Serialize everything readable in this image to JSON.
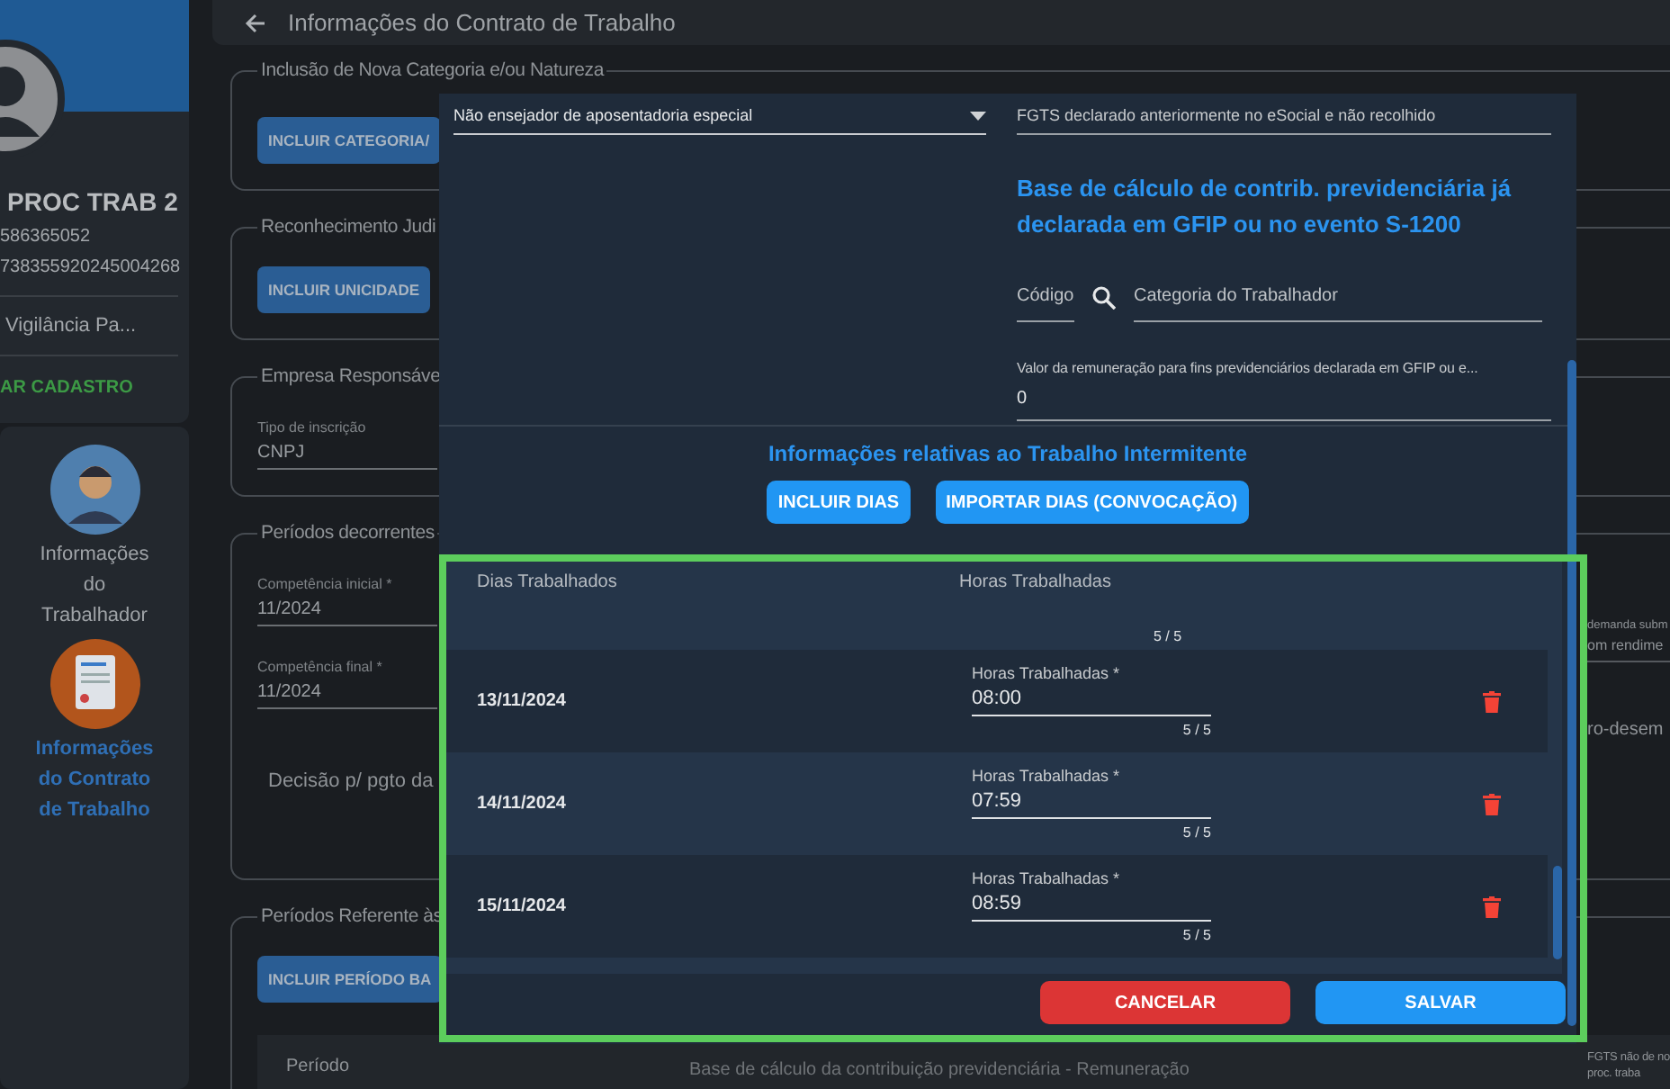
{
  "sidebar": {
    "profile": {
      "name": "PROC TRAB 2",
      "id_1": "586365052",
      "id_2": "738355920245004268",
      "role": "Vigilância Pa...",
      "action": "AR CADASTRO"
    },
    "nav": [
      {
        "label": "Informações do Trabalhador",
        "selected": false,
        "kind": "worker"
      },
      {
        "label": "Informações do Contrato de Trabalho",
        "selected": true,
        "kind": "contract"
      }
    ]
  },
  "header": {
    "title": "Informações do Contrato de Trabalho"
  },
  "sections": [
    {
      "legend": "Inclusão de Nova Categoria e/ou Natureza",
      "button": "INCLUIR CATEGORIA/"
    },
    {
      "legend": "Reconhecimento Judi",
      "button": "INCLUIR UNICIDADE"
    },
    {
      "legend": "Empresa Responsáve",
      "fields": [
        {
          "label": "Tipo de inscrição",
          "value": "CNPJ"
        }
      ]
    },
    {
      "legend": "Períodos decorrentes",
      "fields": [
        {
          "label": "Competência inicial *",
          "value": "11/2024"
        },
        {
          "label": "Competência final *",
          "value": "11/2024"
        }
      ],
      "note": "Decisão p/ pgto da",
      "side_field": {
        "label": "demanda subm",
        "value": "om rendime"
      },
      "side_note": "ro-desem"
    },
    {
      "legend": "Períodos Referente às",
      "button": "INCLUIR PERÍODO BA",
      "columns": [
        "Período",
        "Base de cálculo da contribuição previdenciária - Remuneração"
      ],
      "side_column": "FGTS não de no proc. traba"
    }
  ],
  "dialog": {
    "select": {
      "value": "Não ensejador de aposentadoria especial"
    },
    "fgts_field": {
      "value": "FGTS declarado anteriormente no eSocial e não recolhido"
    },
    "base_heading": "Base de cálculo de contrib. previdenciária já declarada em GFIP ou no evento S-1200",
    "code_field": {
      "placeholder": "Código"
    },
    "category_field": {
      "placeholder": "Categoria do Trabalhador"
    },
    "remuneration_field": {
      "label": "Valor da remuneração para fins previdenciários declarada em GFIP ou e...",
      "value": "0"
    },
    "intermittent": {
      "title": "Informações relativas ao Trabalho Intermitente",
      "buttons": [
        "INCLUIR DIAS",
        "IMPORTAR DIAS (CONVOCAÇÃO)"
      ]
    },
    "table": {
      "columns": [
        "Dias Trabalhados",
        "Horas Trabalhadas"
      ],
      "scrolled_counter": "5 / 5",
      "rows": [
        {
          "date": "13/11/2024",
          "label": "Horas Trabalhadas *",
          "value": "08:00",
          "counter": "5 / 5"
        },
        {
          "date": "14/11/2024",
          "label": "Horas Trabalhadas *",
          "value": "07:59",
          "counter": "5 / 5"
        },
        {
          "date": "15/11/2024",
          "label": "Horas Trabalhadas *",
          "value": "08:59",
          "counter": "5 / 5"
        }
      ]
    },
    "footer": {
      "cancel": "CANCELAR",
      "save": "SALVAR"
    }
  }
}
